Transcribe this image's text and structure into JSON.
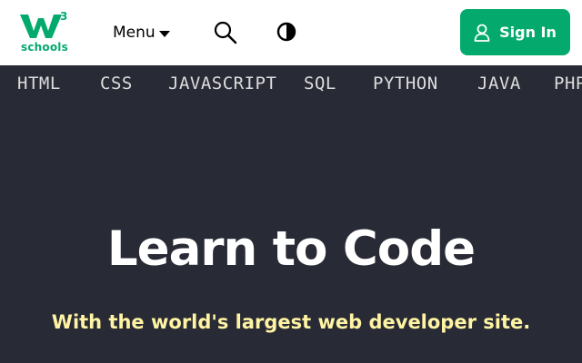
{
  "header": {
    "logo": {
      "mark": "w",
      "superscript": "3",
      "wordmark": "schools",
      "color": "#04aa6d"
    },
    "menu_label": "Menu",
    "search_icon": "search-icon",
    "theme_icon": "contrast-icon",
    "signin": {
      "label": "Sign In",
      "icon": "user-icon",
      "color": "#04aa6d"
    }
  },
  "nav": {
    "items": [
      {
        "label": "HTML"
      },
      {
        "label": "CSS"
      },
      {
        "label": "JAVASCRIPT"
      },
      {
        "label": "SQL"
      },
      {
        "label": "PYTHON"
      },
      {
        "label": "JAVA"
      },
      {
        "label": "PHP"
      }
    ]
  },
  "hero": {
    "title": "Learn to Code",
    "subtitle": "With the world's largest web developer site.",
    "title_color": "#ffffff",
    "subtitle_color": "#fff4a3",
    "background": "#282a35"
  }
}
